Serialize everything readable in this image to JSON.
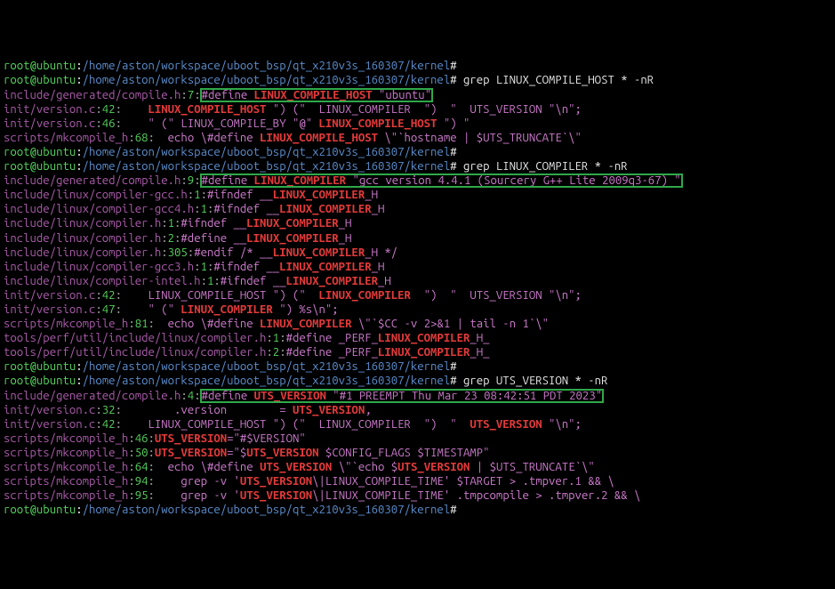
{
  "prompt": {
    "user": "root@ubuntu",
    "path": "/home/aston/workspace/uboot_bsp/qt_x210v3s_160307/kernel",
    "hash": "#"
  },
  "truncated_line": "root@ubuntu:/home/aston/workspace/uboot_bsp/qt_x210v3s_160307/kernel#",
  "cmd1": "grep LINUX_COMPILE_HOST * -nR",
  "r1": [
    {
      "file": "include/generated/compile.h",
      "ln": "7",
      "pre": "#define ",
      "kw": "LINUX_COMPILE_HOST",
      "post": " \"ubuntu\"",
      "hl": true
    },
    {
      "file": "init/version.c",
      "ln": "42",
      "pre": "    ",
      "kw": "LINUX_COMPILE_HOST",
      "post": " \") (\"  LINUX_COMPILER  \")  \"  UTS_VERSION \"\\n\";"
    },
    {
      "file": "init/version.c",
      "ln": "46",
      "pre": "    \" (\" LINUX_COMPILE_BY \"@\" ",
      "kw": "LINUX_COMPILE_HOST",
      "post": " \") \""
    },
    {
      "file": "scripts/mkcompile_h",
      "ln": "68",
      "pre": "  echo \\#define ",
      "kw": "LINUX_COMPILE_HOST",
      "post": " \\\"`hostname | $UTS_TRUNCATE`\\\""
    }
  ],
  "cmd2": "grep LINUX_COMPILER * -nR",
  "r2": [
    {
      "file": "include/generated/compile.h",
      "ln": "9",
      "pre": "#define ",
      "kw": "LINUX_COMPILER",
      "post": " \"gcc version 4.4.1 (Sourcery G++ Lite 2009q3-67) \"",
      "hl": true
    },
    {
      "file": "include/linux/compiler-gcc.h",
      "ln": "1",
      "pre": "#ifndef __",
      "kw": "LINUX_COMPILER",
      "post": "_H"
    },
    {
      "file": "include/linux/compiler-gcc4.h",
      "ln": "1",
      "pre": "#ifndef __",
      "kw": "LINUX_COMPILER",
      "post": "_H"
    },
    {
      "file": "include/linux/compiler.h",
      "ln": "1",
      "pre": "#ifndef __",
      "kw": "LINUX_COMPILER",
      "post": "_H"
    },
    {
      "file": "include/linux/compiler.h",
      "ln": "2",
      "pre": "#define __",
      "kw": "LINUX_COMPILER",
      "post": "_H"
    },
    {
      "file": "include/linux/compiler.h",
      "ln": "305",
      "pre": "#endif /* __",
      "kw": "LINUX_COMPILER",
      "post": "_H */"
    },
    {
      "file": "include/linux/compiler-gcc3.h",
      "ln": "1",
      "pre": "#ifndef __",
      "kw": "LINUX_COMPILER",
      "post": "_H"
    },
    {
      "file": "include/linux/compiler-intel.h",
      "ln": "1",
      "pre": "#ifndef __",
      "kw": "LINUX_COMPILER",
      "post": "_H"
    },
    {
      "file": "init/version.c",
      "ln": "42",
      "pre": "    LINUX_COMPILE_HOST \") (\"  ",
      "kw": "LINUX_COMPILER",
      "post": "  \")  \"  UTS_VERSION \"\\n\";"
    },
    {
      "file": "init/version.c",
      "ln": "47",
      "pre": "    \" (\" ",
      "kw": "LINUX_COMPILER",
      "post": " \") %s\\n\";"
    },
    {
      "file": "scripts/mkcompile_h",
      "ln": "81",
      "pre": "  echo \\#define ",
      "kw": "LINUX_COMPILER",
      "post": " \\\"`$CC -v 2>&1 | tail -n 1`\\\""
    },
    {
      "file": "tools/perf/util/include/linux/compiler.h",
      "ln": "1",
      "pre": "#define _PERF_",
      "kw": "LINUX_COMPILER",
      "post": "_H_"
    },
    {
      "file": "tools/perf/util/include/linux/compiler.h",
      "ln": "2",
      "pre": "#define _PERF_",
      "kw": "LINUX_COMPILER",
      "post": "_H_"
    }
  ],
  "cmd3": "grep UTS_VERSION * -nR",
  "r3": [
    {
      "file": "include/generated/compile.h",
      "ln": "4",
      "pre": "#define ",
      "kw": "UTS_VERSION",
      "post": " \"#1 PREEMPT Thu Mar 23 08:42:51 PDT 2023\"",
      "hl": true
    },
    {
      "file": "init/version.c",
      "ln": "32",
      "pre": "        .version        = ",
      "kw": "UTS_VERSION",
      "post": ","
    },
    {
      "file": "init/version.c",
      "ln": "42",
      "pre": "    LINUX_COMPILE_HOST \") (\"  LINUX_COMPILER  \")  \"  ",
      "kw": "UTS_VERSION",
      "post": " \"\\n\";"
    },
    {
      "file": "scripts/mkcompile_h",
      "ln": "46",
      "pre": "",
      "kw": "UTS_VERSION",
      "post": "=\"#$VERSION\""
    },
    {
      "file": "scripts/mkcompile_h",
      "ln": "50",
      "pre": "",
      "kw": "UTS_VERSION",
      "post": "=\"$",
      "kw2": "UTS_VERSION",
      "post2": " $CONFIG_FLAGS $TIMESTAMP\""
    },
    {
      "file": "scripts/mkcompile_h",
      "ln": "64",
      "pre": "  echo \\#define ",
      "kw": "UTS_VERSION",
      "post": " \\\"`echo $",
      "kw2": "UTS_VERSION",
      "post2": " | $UTS_TRUNCATE`\\\""
    },
    {
      "file": "scripts/mkcompile_h",
      "ln": "94",
      "pre": "    grep -v '",
      "kw": "UTS_VERSION",
      "post": "\\|LINUX_COMPILE_TIME' $TARGET > .tmpver.1 && \\"
    },
    {
      "file": "scripts/mkcompile_h",
      "ln": "95",
      "pre": "    grep -v '",
      "kw": "UTS_VERSION",
      "post": "\\|LINUX_COMPILE_TIME' .tmpcompile > .tmpver.2 && \\"
    }
  ]
}
